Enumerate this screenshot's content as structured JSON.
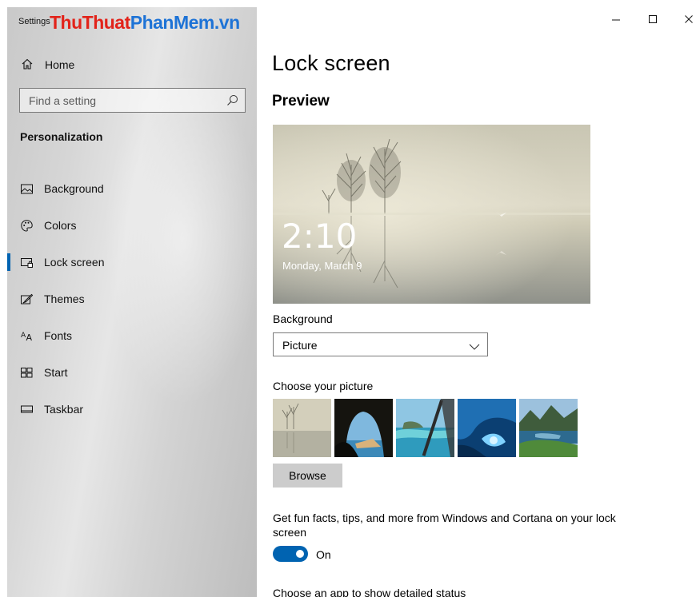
{
  "window": {
    "app_title": "Settings",
    "watermark_part1": "ThuThuat",
    "watermark_part2": "PhanMem",
    "watermark_part3": ".vn",
    "controls": {
      "minimize": "minimize-icon",
      "maximize": "maximize-icon",
      "close": "close-icon"
    }
  },
  "sidebar": {
    "home_label": "Home",
    "search_placeholder": "Find a setting",
    "section_title": "Personalization",
    "items": [
      {
        "label": "Background",
        "icon": "picture-icon"
      },
      {
        "label": "Colors",
        "icon": "palette-icon"
      },
      {
        "label": "Lock screen",
        "icon": "lock-screen-icon",
        "selected": true
      },
      {
        "label": "Themes",
        "icon": "brush-icon"
      },
      {
        "label": "Fonts",
        "icon": "font-icon"
      },
      {
        "label": "Start",
        "icon": "start-grid-icon"
      },
      {
        "label": "Taskbar",
        "icon": "taskbar-icon"
      }
    ]
  },
  "main": {
    "title": "Lock screen",
    "preview_title": "Preview",
    "preview_time": "2:10",
    "preview_date": "Monday, March 9",
    "background_label": "Background",
    "background_value": "Picture",
    "choose_picture_label": "Choose your picture",
    "browse_label": "Browse",
    "facts_text": "Get fun facts, tips, and more from Windows and Cortana on your lock screen",
    "facts_toggle_state": "On",
    "detail_status_label": "Choose an app to show detailed status"
  },
  "colors": {
    "accent": "#0063b1",
    "watermark_red": "#e2231a",
    "watermark_blue": "#1e73d6"
  }
}
